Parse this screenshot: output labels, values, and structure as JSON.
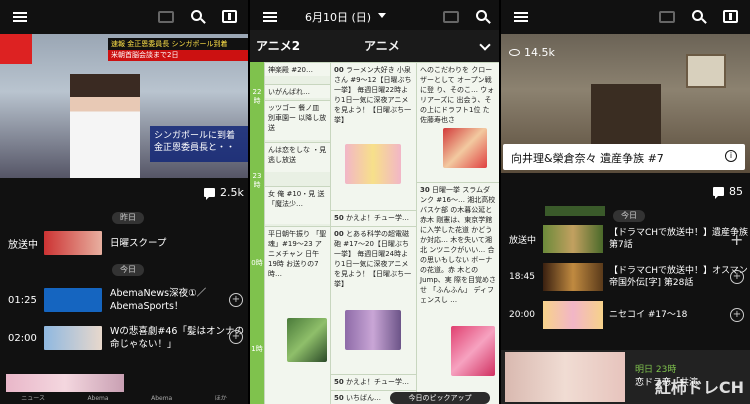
{
  "panel1": {
    "comment_count": "2.5k",
    "ticker": "速報 金正恩委員長 シンガポール到着",
    "ticker_sub": "米朝首脳会談まで2日",
    "caption": "シンガポールに到着 金正恩委員長と・・",
    "rows": [
      {
        "time": "放送中",
        "title": "日曜スクープ",
        "day": "昨日",
        "color": "#c33"
      },
      {
        "time": "01:25",
        "title": "AbemaNews深夜①／AbemaSports！",
        "day": "今日",
        "color": "#1565c0"
      },
      {
        "time": "02:00",
        "title": "Wの悲喜劇#46「髪はオンナの命じゃない！」",
        "day": "",
        "color": "#8fb8e0"
      }
    ],
    "nav": [
      "ニュース",
      "Abema",
      "Abema",
      "ほか"
    ]
  },
  "panel2": {
    "date": "6月10日 (日)",
    "channels": [
      "アニメ2",
      "アニメ"
    ],
    "hours": [
      "22時",
      "23時",
      "0時",
      "1時"
    ],
    "col1": [
      {
        "text": "神楽殿 #20…"
      },
      {
        "text": "いがんばれ…"
      },
      {
        "text": "ッツゴー 餐ノ皿 別車園ー 以降し放送"
      },
      {
        "text": "んは恋をしな ・見逃し放送"
      },
      {
        "text": "女 俺 #10・見 送 「魔法少…"
      },
      {
        "text": "平日朝午振り 「聖魂」#19〜23 アニメチャン 日午19時 お送りの7時…"
      }
    ],
    "col2": [
      {
        "min": "00",
        "text": "ラーメン大好き 小泉さん #9〜12【日曜ぶち一挙】 毎週日曜22時より1日一気に深夜アニメを見よう！【日曜ぶち一挙】"
      },
      {
        "min": "50",
        "text": "かえよ！チュー学…"
      },
      {
        "min": "00",
        "text": "とある科学の超電磁砲 #17〜20【日曜ぶち一挙】 毎週日曜24時より1日一気に深夜アニメを見よう！【日曜ぶち一挙】"
      },
      {
        "min": "50",
        "text": "かえよ！チュー学…"
      },
      {
        "min": "50",
        "text": "いちばん…"
      }
    ],
    "col3": [
      {
        "min": "",
        "text": "へのこだわりを クローザーとして オープン戦に登 り、そのこ… ウォリアーズに 出会う、その上にドラフト1位 た佐藤寿也さ"
      },
      {
        "min": "30",
        "text": "日曜一挙 スラムダンク #16〜… 湘北高校バスケ部 の木暮公延と赤木 剛憲は、東京学館 に入学した花道 かどうか対応… 木を失いて湘北 ンツニクがいい… 合の思いもしない ボーナの花道。赤 木とのJump、実 際を目覚めさせ 「ふんふん」 ディフェンスし …"
      }
    ],
    "pickup": "今日のピックアップ"
  },
  "panel3": {
    "views": "14.5k",
    "title": "向井理&榮倉奈々 遺産争族 #7",
    "comment_count": "85",
    "day": "今日",
    "rows": [
      {
        "time": "放送中",
        "title": "【ドラマCHで放送中！】遺産争族 第7話",
        "action": "+"
      },
      {
        "time": "18:45",
        "title": "【ドラマCHで放送中！】オスマン帝国外伝[字] 第28話",
        "action": "alarm"
      },
      {
        "time": "20:00",
        "title": "ニセコイ #17〜18",
        "action": "alarm"
      }
    ],
    "next_time": "明日 23時",
    "next_title": "恋ドラ恋「共演",
    "watermark": "紅柿ドレCH"
  },
  "colors": {
    "accent_green": "#7fc24d",
    "live_red": "#c33"
  }
}
